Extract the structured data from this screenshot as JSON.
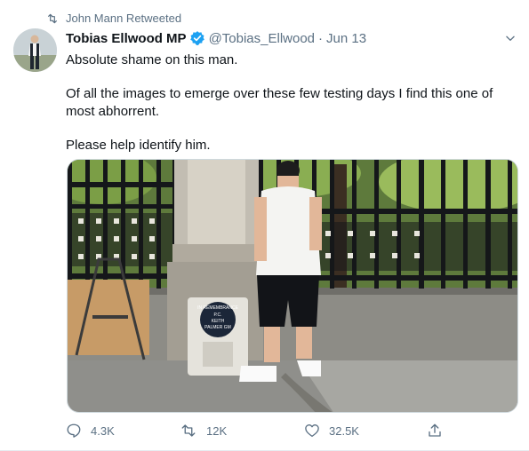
{
  "retweet": {
    "label": "John Mann Retweeted",
    "icon": "retweet-icon"
  },
  "author": {
    "name": "Tobias Ellwood MP",
    "handle": "@Tobias_Ellwood",
    "separator": "·",
    "date": "Jun 13",
    "verified": true
  },
  "tweet": {
    "paragraphs": [
      "Absolute shame on this man.",
      "Of all the images to emerge over these few testing days I find this one of most abhorrent.",
      "Please help identify him."
    ]
  },
  "media": {
    "memorial_stone_lines": [
      "IN REMEMBRANCE",
      "P.C.",
      "KEITH",
      "PALMER GM"
    ]
  },
  "actions": {
    "replies": "4.3K",
    "retweets": "12K",
    "likes": "32.5K",
    "share_icon": "share-icon"
  },
  "colors": {
    "accent": "#1da1f2",
    "muted": "#5b7083",
    "text": "#0f1419"
  }
}
